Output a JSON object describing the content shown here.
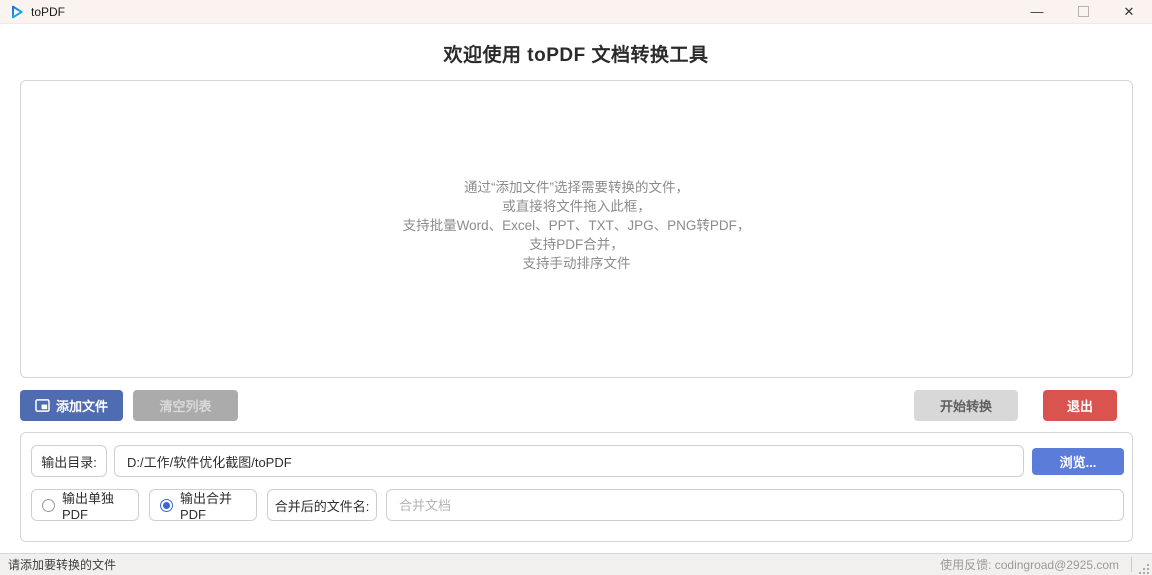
{
  "window": {
    "title": "toPDF",
    "icons": {
      "minimize": "—",
      "close": "✕"
    }
  },
  "header": {
    "title": "欢迎使用 toPDF 文档转换工具"
  },
  "drop_zone": {
    "line1": "通过“添加文件”选择需要转换的文件，",
    "line2": "或直接将文件拖入此框，",
    "line3": "支持批量Word、Excel、PPT、TXT、JPG、PNG转PDF，",
    "line4": "支持PDF合并，",
    "line5": "支持手动排序文件"
  },
  "actions": {
    "add_files": "添加文件",
    "clear_list": "清空列表",
    "start_convert": "开始转换",
    "exit": "退出"
  },
  "output": {
    "dir_label": "输出目录:",
    "dir_value": "D:/工作/软件优化截图/toPDF",
    "browse": "浏览...",
    "radio_single": "输出单独PDF",
    "radio_merge": "输出合并PDF",
    "merge_name_label": "合并后的文件名:",
    "merge_name_placeholder": "合并文档"
  },
  "status_bar": {
    "left": "请添加要转换的文件",
    "right": "使用反馈: codingroad@2925.com"
  },
  "colors": {
    "primary_blue": "#4f6cb0",
    "browse_blue": "#5b7cd9",
    "exit_red": "#d9534f",
    "disabled_gray": "#ababab",
    "titlebar_bg": "#faf3ef"
  }
}
